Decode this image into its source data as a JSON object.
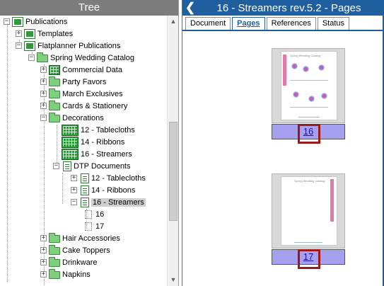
{
  "tree": {
    "title": "Tree",
    "nodes": [
      {
        "label": "Publications",
        "expander": "−",
        "icon": "publication-icon"
      },
      {
        "label": "Templates",
        "expander": "+",
        "icon": "publication-icon"
      },
      {
        "label": "Flatplanner Publications",
        "expander": "−",
        "icon": "publication-icon"
      },
      {
        "label": "Spring Wedding Catalog",
        "expander": "−",
        "icon": "folder-icon"
      },
      {
        "label": "Commercial Data",
        "expander": "+",
        "icon": "grid-icon"
      },
      {
        "label": "Party Favors",
        "expander": "+",
        "icon": "folder-icon"
      },
      {
        "label": "March Exclusives",
        "expander": "+",
        "icon": "folder-icon"
      },
      {
        "label": "Cards & Stationery",
        "expander": "+",
        "icon": "folder-icon"
      },
      {
        "label": "Decorations",
        "expander": "−",
        "icon": "folder-icon"
      },
      {
        "label": "12 - Tablecloths",
        "expander": "",
        "icon": "grid-icon"
      },
      {
        "label": "14 - Ribbons",
        "expander": "",
        "icon": "grid-icon"
      },
      {
        "label": "16 - Streamers",
        "expander": "",
        "icon": "grid-icon"
      },
      {
        "label": "DTP Documents",
        "expander": "−",
        "icon": "document-icon"
      },
      {
        "label": "12 - Tablecloths",
        "expander": "+",
        "icon": "document-icon"
      },
      {
        "label": "14 - Ribbons",
        "expander": "+",
        "icon": "document-icon"
      },
      {
        "label": "16 - Streamers",
        "expander": "−",
        "icon": "document-icon"
      },
      {
        "label": "16",
        "expander": "",
        "icon": "page-icon"
      },
      {
        "label": "17",
        "expander": "",
        "icon": "page-icon"
      },
      {
        "label": "Hair Accessories",
        "expander": "+",
        "icon": "folder-icon"
      },
      {
        "label": "Cake Toppers",
        "expander": "+",
        "icon": "folder-icon"
      },
      {
        "label": "Drinkware",
        "expander": "+",
        "icon": "folder-icon"
      },
      {
        "label": "Napkins",
        "expander": "+",
        "icon": "folder-icon"
      }
    ]
  },
  "panel": {
    "title": "16 - Streamers rev.5.2 - Pages",
    "back": "❮",
    "tabs": [
      "Document",
      "Pages",
      "References",
      "Status"
    ],
    "active_tab": "Pages",
    "pages": [
      {
        "number": "16",
        "thumb_heading": "Spring Wedding Catalog"
      },
      {
        "number": "17",
        "thumb_heading": "Spring Wedding Catalog"
      }
    ]
  },
  "colors": {
    "header_blue": "#1f5fa0",
    "tree_header": "#7d7d7d",
    "page_number_bar": "#a7a0ee",
    "highlight": "#9b1b1b",
    "accent_pink": "#e27aa7"
  }
}
